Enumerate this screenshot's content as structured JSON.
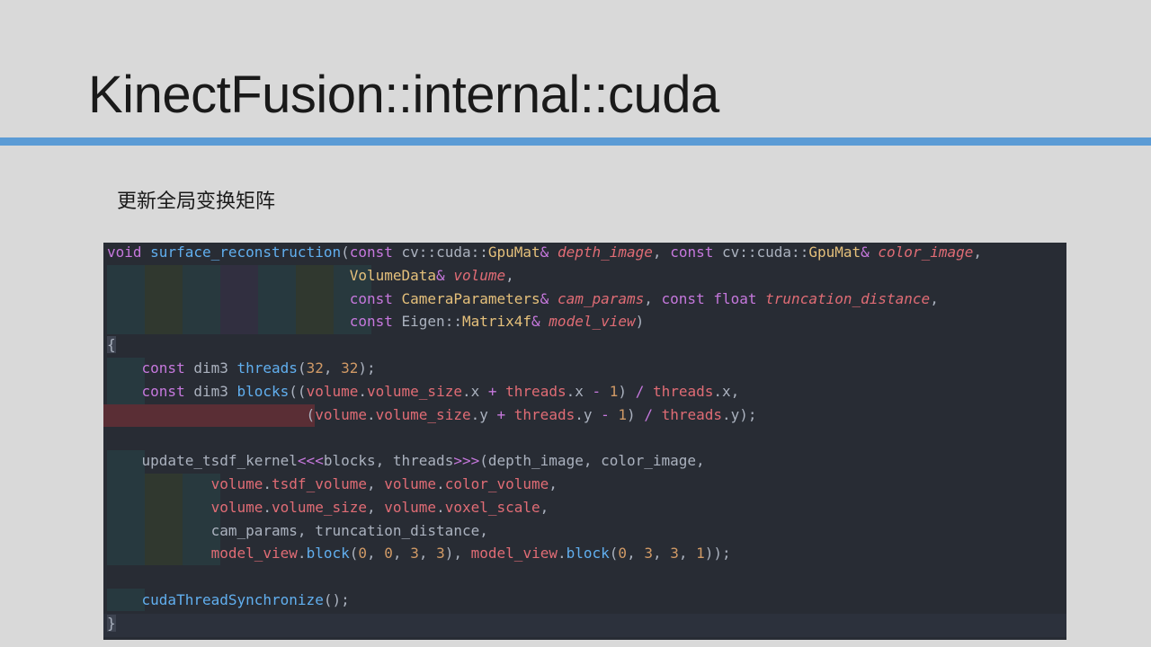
{
  "slide": {
    "title": "KinectFusion::internal::cuda",
    "subtitle": "更新全局变换矩阵",
    "accent_color": "#5b9bd5"
  },
  "code": {
    "language": "cuda",
    "lines": [
      [
        [
          "kw",
          "void"
        ],
        [
          "pl",
          " "
        ],
        [
          "fn",
          "surface_reconstruction"
        ],
        [
          "pl",
          "("
        ],
        [
          "kw",
          "const"
        ],
        [
          "pl",
          " cv::cuda::"
        ],
        [
          "ty",
          "GpuMat"
        ],
        [
          "op",
          "&"
        ],
        [
          "pl",
          " "
        ],
        [
          "pa",
          "depth_image"
        ],
        [
          "pl",
          ", "
        ],
        [
          "kw",
          "const"
        ],
        [
          "pl",
          " cv::cuda::"
        ],
        [
          "ty",
          "GpuMat"
        ],
        [
          "op",
          "&"
        ],
        [
          "pl",
          " "
        ],
        [
          "pa",
          "color_image"
        ],
        [
          "pl",
          ","
        ]
      ],
      [
        [
          "pl",
          "                            "
        ],
        [
          "ty",
          "VolumeData"
        ],
        [
          "op",
          "&"
        ],
        [
          "pl",
          " "
        ],
        [
          "pa",
          "volume"
        ],
        [
          "pl",
          ","
        ]
      ],
      [
        [
          "pl",
          "                            "
        ],
        [
          "kw",
          "const"
        ],
        [
          "pl",
          " "
        ],
        [
          "ty",
          "CameraParameters"
        ],
        [
          "op",
          "&"
        ],
        [
          "pl",
          " "
        ],
        [
          "pa",
          "cam_params"
        ],
        [
          "pl",
          ", "
        ],
        [
          "kw",
          "const"
        ],
        [
          "pl",
          " "
        ],
        [
          "kw",
          "float"
        ],
        [
          "pl",
          " "
        ],
        [
          "pa",
          "truncation_distance"
        ],
        [
          "pl",
          ","
        ]
      ],
      [
        [
          "pl",
          "                            "
        ],
        [
          "kw",
          "const"
        ],
        [
          "pl",
          " Eigen::"
        ],
        [
          "ty",
          "Matrix4f"
        ],
        [
          "op",
          "&"
        ],
        [
          "pl",
          " "
        ],
        [
          "pa",
          "model_view"
        ],
        [
          "pl",
          ")"
        ]
      ],
      [
        [
          "br",
          "{"
        ]
      ],
      [
        [
          "pl",
          "    "
        ],
        [
          "kw",
          "const"
        ],
        [
          "pl",
          " dim3 "
        ],
        [
          "fn",
          "threads"
        ],
        [
          "pl",
          "("
        ],
        [
          "nu",
          "32"
        ],
        [
          "pl",
          ", "
        ],
        [
          "nu",
          "32"
        ],
        [
          "pl",
          ");"
        ]
      ],
      [
        [
          "pl",
          "    "
        ],
        [
          "kw",
          "const"
        ],
        [
          "pl",
          " dim3 "
        ],
        [
          "fn",
          "blocks"
        ],
        [
          "pl",
          "(("
        ],
        [
          "va",
          "volume"
        ],
        [
          "pl",
          "."
        ],
        [
          "va",
          "volume_size"
        ],
        [
          "pl",
          ".x "
        ],
        [
          "op",
          "+"
        ],
        [
          "pl",
          " "
        ],
        [
          "va",
          "threads"
        ],
        [
          "pl",
          ".x "
        ],
        [
          "op",
          "-"
        ],
        [
          "pl",
          " "
        ],
        [
          "nu",
          "1"
        ],
        [
          "pl",
          ") "
        ],
        [
          "op",
          "/"
        ],
        [
          "pl",
          " "
        ],
        [
          "va",
          "threads"
        ],
        [
          "pl",
          ".x,"
        ]
      ],
      [
        [
          "pl",
          "                       ("
        ],
        [
          "va",
          "volume"
        ],
        [
          "pl",
          "."
        ],
        [
          "va",
          "volume_size"
        ],
        [
          "pl",
          ".y "
        ],
        [
          "op",
          "+"
        ],
        [
          "pl",
          " "
        ],
        [
          "va",
          "threads"
        ],
        [
          "pl",
          ".y "
        ],
        [
          "op",
          "-"
        ],
        [
          "pl",
          " "
        ],
        [
          "nu",
          "1"
        ],
        [
          "pl",
          ") "
        ],
        [
          "op",
          "/"
        ],
        [
          "pl",
          " "
        ],
        [
          "va",
          "threads"
        ],
        [
          "pl",
          ".y);"
        ]
      ],
      [],
      [
        [
          "pl",
          "    update_tsdf_kernel"
        ],
        [
          "op",
          "<<<"
        ],
        [
          "pl",
          "blocks, threads"
        ],
        [
          "op",
          ">>>"
        ],
        [
          "pl",
          "(depth_image, color_image,"
        ]
      ],
      [
        [
          "pl",
          "            "
        ],
        [
          "va",
          "volume"
        ],
        [
          "pl",
          "."
        ],
        [
          "va",
          "tsdf_volume"
        ],
        [
          "pl",
          ", "
        ],
        [
          "va",
          "volume"
        ],
        [
          "pl",
          "."
        ],
        [
          "va",
          "color_volume"
        ],
        [
          "pl",
          ","
        ]
      ],
      [
        [
          "pl",
          "            "
        ],
        [
          "va",
          "volume"
        ],
        [
          "pl",
          "."
        ],
        [
          "va",
          "volume_size"
        ],
        [
          "pl",
          ", "
        ],
        [
          "va",
          "volume"
        ],
        [
          "pl",
          "."
        ],
        [
          "va",
          "voxel_scale"
        ],
        [
          "pl",
          ","
        ]
      ],
      [
        [
          "pl",
          "            cam_params, truncation_distance,"
        ]
      ],
      [
        [
          "pl",
          "            "
        ],
        [
          "va",
          "model_view"
        ],
        [
          "pl",
          "."
        ],
        [
          "fn",
          "block"
        ],
        [
          "pl",
          "("
        ],
        [
          "nu",
          "0"
        ],
        [
          "pl",
          ", "
        ],
        [
          "nu",
          "0"
        ],
        [
          "pl",
          ", "
        ],
        [
          "nu",
          "3"
        ],
        [
          "pl",
          ", "
        ],
        [
          "nu",
          "3"
        ],
        [
          "pl",
          "), "
        ],
        [
          "va",
          "model_view"
        ],
        [
          "pl",
          "."
        ],
        [
          "fn",
          "block"
        ],
        [
          "pl",
          "("
        ],
        [
          "nu",
          "0"
        ],
        [
          "pl",
          ", "
        ],
        [
          "nu",
          "3"
        ],
        [
          "pl",
          ", "
        ],
        [
          "nu",
          "3"
        ],
        [
          "pl",
          ", "
        ],
        [
          "nu",
          "1"
        ],
        [
          "pl",
          "));"
        ]
      ],
      [],
      [
        [
          "pl",
          "    "
        ],
        [
          "fn",
          "cudaThreadSynchronize"
        ],
        [
          "pl",
          "();"
        ]
      ],
      [
        [
          "br",
          "}"
        ]
      ]
    ]
  }
}
